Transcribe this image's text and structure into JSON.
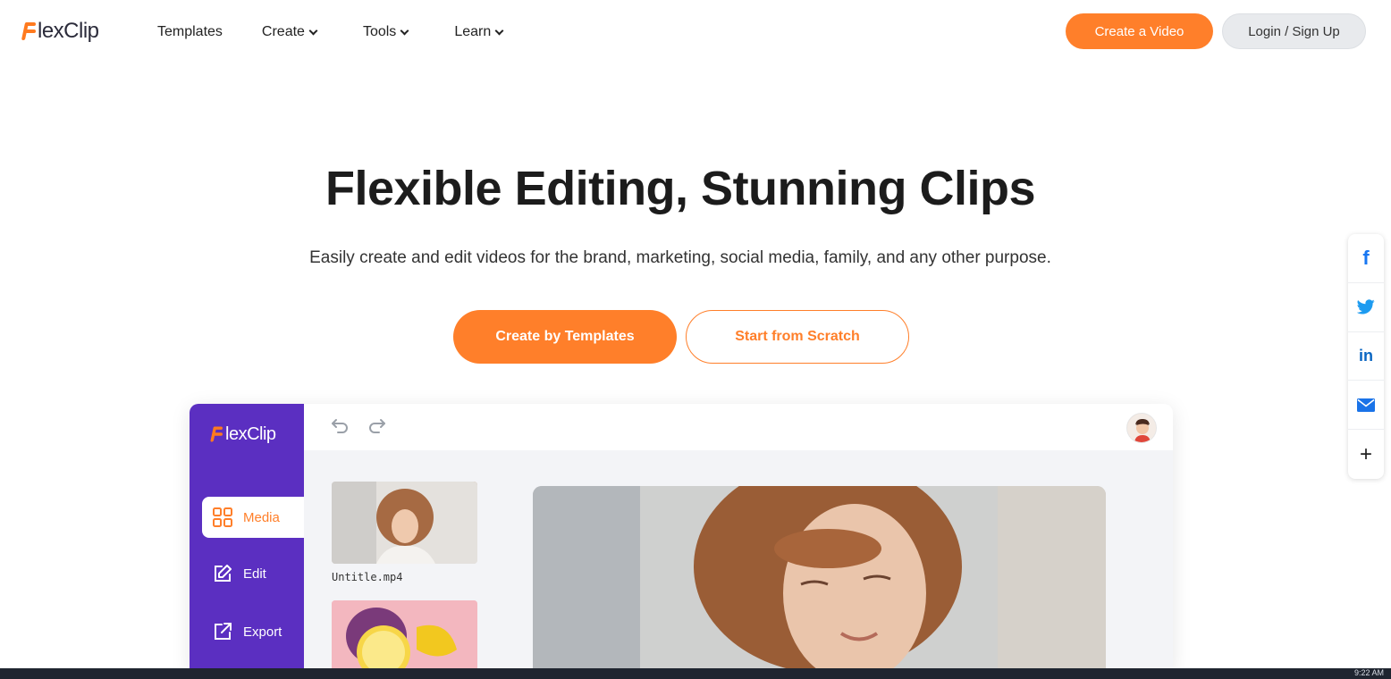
{
  "brand": {
    "logo_text": "lexClip",
    "accent": "#ff7f2a",
    "editor_purple": "#5b2fc1"
  },
  "nav": {
    "items": [
      {
        "label": "Templates",
        "dropdown": false
      },
      {
        "label": "Create",
        "dropdown": true
      },
      {
        "label": "Tools",
        "dropdown": true
      },
      {
        "label": "Learn",
        "dropdown": true
      }
    ],
    "create_video_label": "Create a Video",
    "login_label": "Login / Sign Up"
  },
  "hero": {
    "title": "Flexible Editing, Stunning Clips",
    "subtitle": "Easily create and edit videos for the brand, marketing, social media, family, and any other purpose.",
    "primary_cta": "Create by Templates",
    "secondary_cta": "Start from Scratch"
  },
  "share": {
    "items": [
      {
        "icon": "facebook-icon",
        "glyph": "f"
      },
      {
        "icon": "twitter-icon"
      },
      {
        "icon": "linkedin-icon",
        "glyph": "in"
      },
      {
        "icon": "mail-icon"
      },
      {
        "icon": "plus-icon",
        "glyph": "+"
      }
    ]
  },
  "editor": {
    "logo_text": "lexClip",
    "sidebar": [
      {
        "label": "Media",
        "icon": "grid-icon",
        "active": true
      },
      {
        "label": "Edit",
        "icon": "edit-icon",
        "active": false
      },
      {
        "label": "Export",
        "icon": "export-icon",
        "active": false
      }
    ],
    "media": [
      {
        "label": "Untitle.mp4"
      }
    ]
  },
  "taskbar": {
    "time": "9:22 AM"
  }
}
